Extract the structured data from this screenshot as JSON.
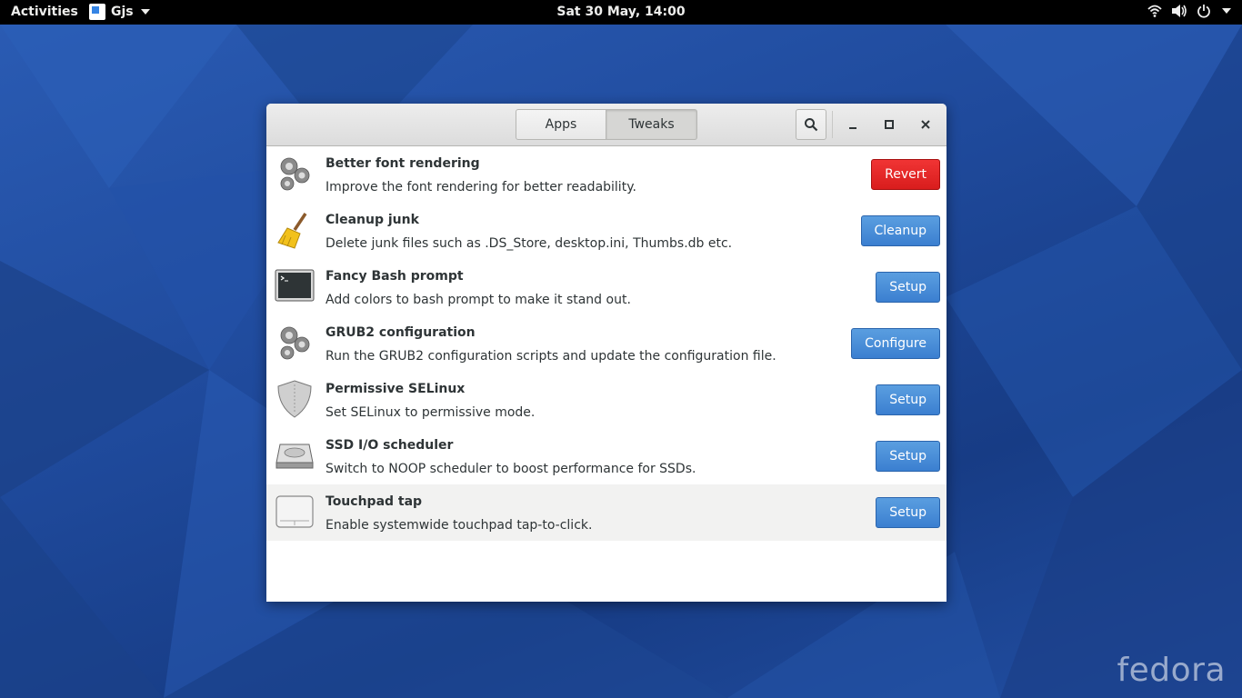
{
  "topbar": {
    "activities": "Activities",
    "app_name": "Gjs",
    "clock": "Sat 30 May, 14:00"
  },
  "desktop": {
    "brand": "fedora"
  },
  "window": {
    "tabs": [
      {
        "label": "Apps",
        "active": false
      },
      {
        "label": "Tweaks",
        "active": true
      }
    ],
    "items": [
      {
        "title": "Better font rendering",
        "description": "Improve the font rendering for better readability.",
        "action": "Revert",
        "style": "red",
        "icon": "gears-icon"
      },
      {
        "title": "Cleanup junk",
        "description": "Delete junk files such as .DS_Store, desktop.ini, Thumbs.db etc.",
        "action": "Cleanup",
        "style": "blue",
        "icon": "broom-icon"
      },
      {
        "title": "Fancy Bash prompt",
        "description": "Add colors to bash prompt to make it stand out.",
        "action": "Setup",
        "style": "blue",
        "icon": "terminal-icon"
      },
      {
        "title": "GRUB2 configuration",
        "description": "Run the GRUB2 configuration scripts and update the configuration file.",
        "action": "Configure",
        "style": "blue",
        "icon": "gears-icon"
      },
      {
        "title": "Permissive SELinux",
        "description": "Set SELinux to permissive mode.",
        "action": "Setup",
        "style": "blue",
        "icon": "shield-icon"
      },
      {
        "title": "SSD I/O scheduler",
        "description": "Switch to NOOP scheduler to boost performance for SSDs.",
        "action": "Setup",
        "style": "blue",
        "icon": "drive-icon"
      },
      {
        "title": "Touchpad tap",
        "description": "Enable systemwide touchpad tap-to-click.",
        "action": "Setup",
        "style": "blue",
        "icon": "touchpad-icon"
      }
    ]
  },
  "colors": {
    "accent_blue": "#3b7fd0",
    "destructive_red": "#d91d1d",
    "desktop_blue": "#1f4a9c"
  }
}
